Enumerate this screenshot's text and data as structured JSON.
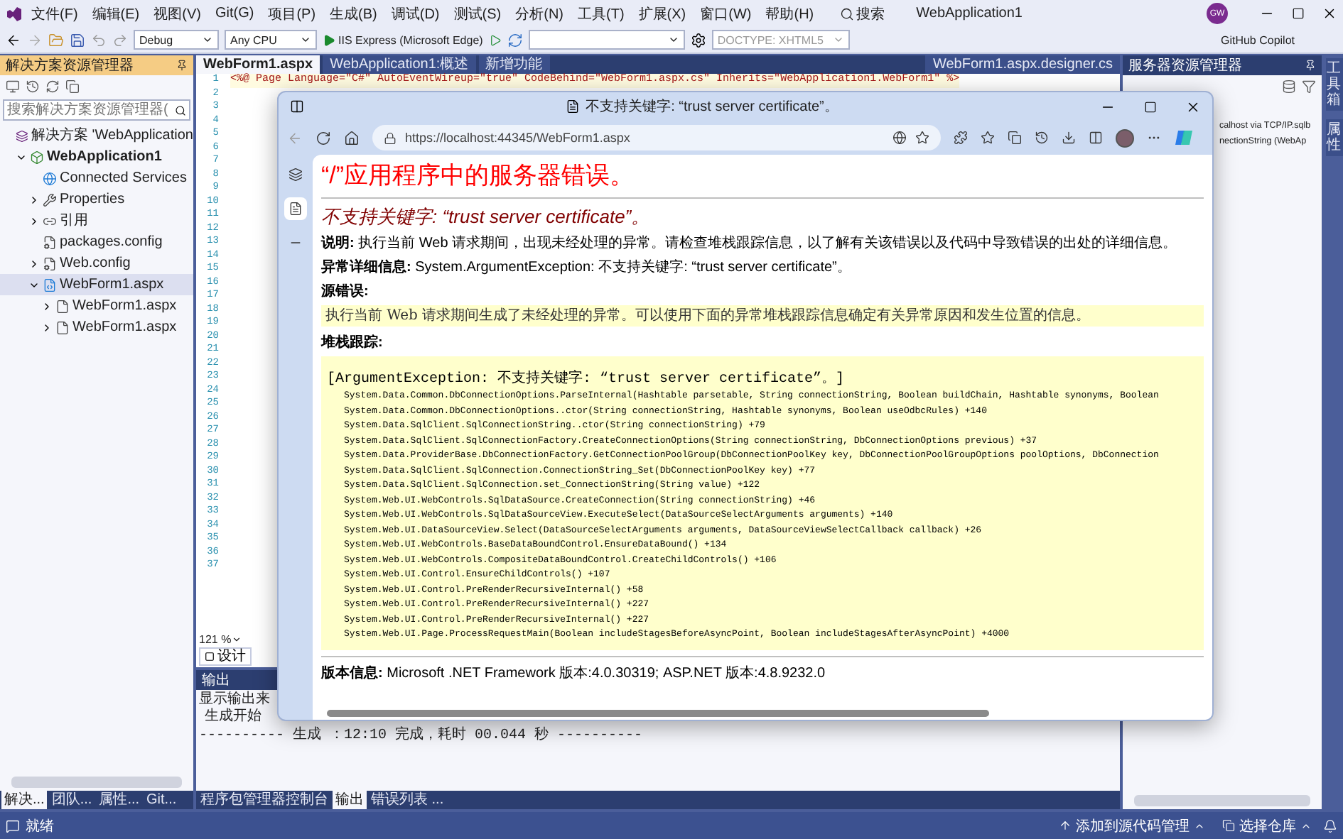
{
  "menu_bar": {
    "items": [
      "文件(F)",
      "编辑(E)",
      "视图(V)",
      "Git(G)",
      "项目(P)",
      "生成(B)",
      "调试(D)",
      "测试(S)",
      "分析(N)",
      "工具(T)",
      "扩展(X)",
      "窗口(W)",
      "帮助(H)"
    ],
    "search": "搜索",
    "title": "WebApplication1",
    "avatar": "GW"
  },
  "toolbar": {
    "configuration": "Debug",
    "platform": "Any CPU",
    "run_target": "IIS Express (Microsoft Edge)",
    "doctype": "DOCTYPE: XHTML5",
    "copilot": "GitHub Copilot"
  },
  "solution_explorer": {
    "title": "解决方案资源管理器",
    "search": {
      "placeholder": "搜索解决方案资源管理器("
    },
    "tree": [
      {
        "label": "解决方案 'WebApplication",
        "kind": "solution",
        "selected": false,
        "children": [
          {
            "label": "WebApplication1",
            "kind": "project",
            "expanded": true,
            "selected": false,
            "children": [
              {
                "label": "Connected Services",
                "kind": "services",
                "selected": false
              },
              {
                "label": "Properties",
                "kind": "properties",
                "expanded": false,
                "selected": false
              },
              {
                "label": "引用",
                "kind": "references",
                "expanded": false,
                "selected": false
              },
              {
                "label": "packages.config",
                "kind": "config",
                "selected": false
              },
              {
                "label": "Web.config",
                "kind": "config",
                "expanded": false,
                "selected": false
              },
              {
                "label": "WebForm1.aspx",
                "kind": "page",
                "expanded": true,
                "selected": true,
                "children": [
                  {
                    "label": "WebForm1.aspx",
                    "kind": "file",
                    "expanded": false,
                    "selected": false
                  },
                  {
                    "label": "WebForm1.aspx",
                    "kind": "file",
                    "expanded": false,
                    "selected": false
                  }
                ]
              }
            ]
          }
        ]
      }
    ],
    "bottom_tabs": [
      {
        "label": "解决...",
        "selected": true
      },
      {
        "label": "团队...",
        "selected": false
      },
      {
        "label": "属性...",
        "selected": false
      },
      {
        "label": "Git...",
        "selected": false
      }
    ]
  },
  "editor": {
    "tabs": [
      {
        "label": "WebForm1.aspx",
        "selected": true
      },
      {
        "label": "WebApplication1:概述",
        "selected": false
      },
      {
        "label": "新增功能",
        "selected": false
      }
    ],
    "right_tab": "WebForm1.aspx.designer.cs",
    "line_numbers": [
      "1",
      "2",
      "3",
      "4",
      "5",
      "6",
      "7",
      "8",
      "9",
      "10",
      "11",
      "12",
      "13",
      "14",
      "15",
      "16",
      "17",
      "18",
      "19",
      "20",
      "21",
      "22",
      "23",
      "24",
      "25",
      "26",
      "27",
      "28",
      "29",
      "30",
      "31",
      "32",
      "33",
      "34",
      "35",
      "36",
      "37"
    ],
    "code_line": "<%@ Page Language=\"C#\" AutoEventWireup=\"true\" CodeBehind=\"WebForm1.aspx.cs\" Inherits=\"WebApplication1.WebForm1\" %>",
    "zoom": "121 %",
    "view_tab": "设计"
  },
  "output": {
    "title": "输出",
    "source_label": "显示输出来",
    "lines": [
      "生成开始",
      "---------- 生成 ：12:10 完成，耗时 00.044 秒 ----------"
    ],
    "tabs": [
      {
        "label": "程序包管理器控制台",
        "selected": false
      },
      {
        "label": "输出",
        "selected": true
      },
      {
        "label": "错误列表 ...",
        "selected": false
      }
    ]
  },
  "server_explorer": {
    "title": "服务器资源管理器",
    "lines": [
      "calhost via TCP/IP.sqlb",
      "nectionString (WebAp"
    ]
  },
  "side_tabs": [
    "工具箱",
    "属性"
  ],
  "browser": {
    "title": "不支持关键字: “trust server certificate”。",
    "url": "https://localhost:44345/WebForm1.aspx",
    "page": {
      "heading": "“/”应用程序中的服务器错误。",
      "error_title": "不支持关键字: “trust server certificate”。",
      "description": "**说明:** 执行当前 Web 请求期间，出现未经处理的异常。请检查堆栈跟踪信息，以了解有关该错误以及代码中导致错误的出处的详细信息。",
      "details": "**异常详细信息:** System.ArgumentException: 不支持关键字: “trust server certificate”。",
      "source_label": "源错误:",
      "source_text": "执行当前 Web 请求期间生成了未经处理的异常。可以使用下面的异常堆栈跟踪信息确定有关异常原因和发生位置的信息。",
      "stack_label": "堆栈跟踪:",
      "stack_lines": [
        "[ArgumentException: 不支持关键字: “trust server certificate”。]",
        "System.Data.Common.DbConnectionOptions.ParseInternal(Hashtable parsetable, String connectionString, Boolean buildChain, Hashtable synonyms, Boolean",
        "System.Data.Common.DbConnectionOptions..ctor(String connectionString, Hashtable synonyms, Boolean useOdbcRules) +140",
        "System.Data.SqlClient.SqlConnectionString..ctor(String connectionString) +79",
        "System.Data.SqlClient.SqlConnectionFactory.CreateConnectionOptions(String connectionString, DbConnectionOptions previous) +37",
        "System.Data.ProviderBase.DbConnectionFactory.GetConnectionPoolGroup(DbConnectionPoolKey key, DbConnectionPoolGroupOptions poolOptions, DbConnection",
        "System.Data.SqlClient.SqlConnection.ConnectionString_Set(DbConnectionPoolKey key) +77",
        "System.Data.SqlClient.SqlConnection.set_ConnectionString(String value) +122",
        "System.Web.UI.WebControls.SqlDataSource.CreateConnection(String connectionString) +46",
        "System.Web.UI.WebControls.SqlDataSourceView.ExecuteSelect(DataSourceSelectArguments arguments) +140",
        "System.Web.UI.DataSourceView.Select(DataSourceSelectArguments arguments, DataSourceViewSelectCallback callback) +26",
        "System.Web.UI.WebControls.BaseDataBoundControl.EnsureDataBound() +134",
        "System.Web.UI.WebControls.CompositeDataBoundControl.CreateChildControls() +106",
        "System.Web.UI.Control.EnsureChildControls() +107",
        "System.Web.UI.Control.PreRenderRecursiveInternal() +58",
        "System.Web.UI.Control.PreRenderRecursiveInternal() +227",
        "System.Web.UI.Control.PreRenderRecursiveInternal() +227",
        "System.Web.UI.Page.ProcessRequestMain(Boolean includeStagesBeforeAsyncPoint, Boolean includeStagesAfterAsyncPoint) +4000"
      ],
      "version": "**版本信息:** Microsoft .NET Framework 版本:4.0.30319; ASP.NET 版本:4.8.9232.0"
    }
  },
  "status_bar": {
    "status": "就绪",
    "source_control": "添加到源代码管理",
    "repo": "选择仓库"
  }
}
